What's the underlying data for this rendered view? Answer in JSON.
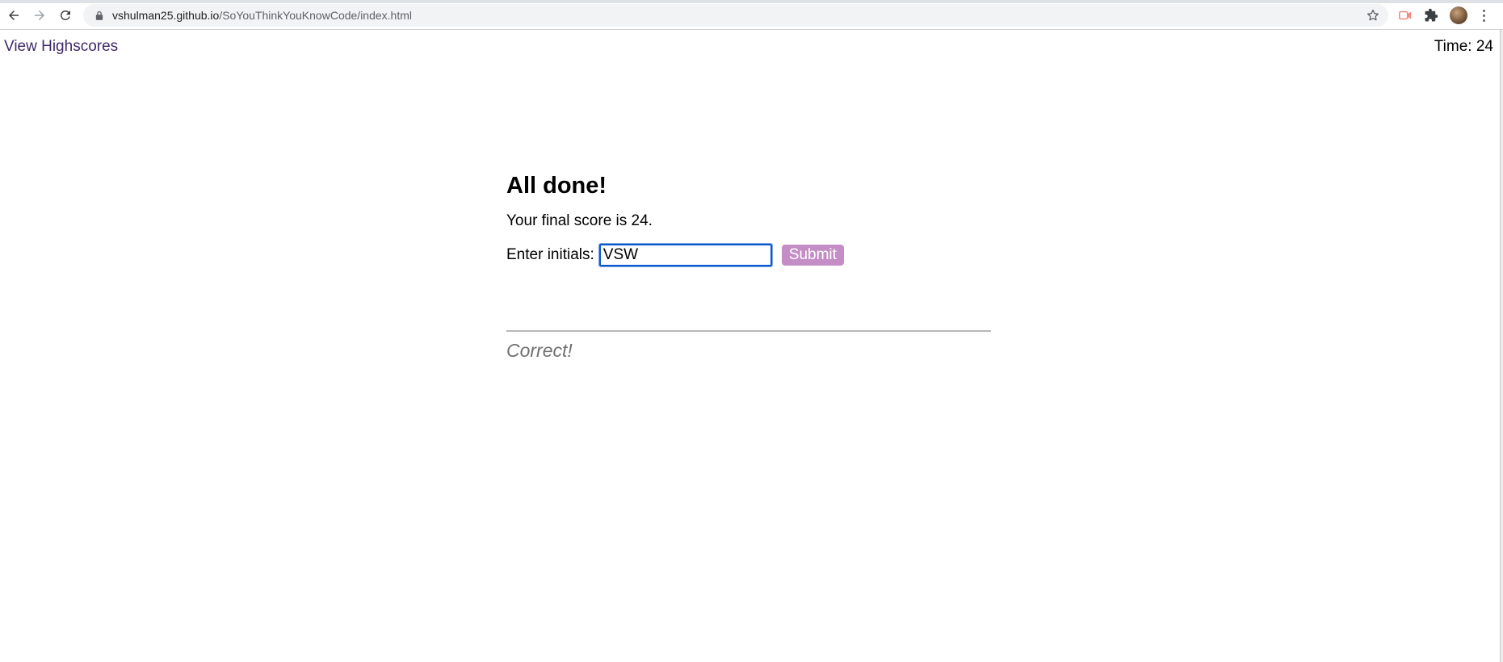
{
  "browser": {
    "url_host": "vshulman25.github.io",
    "url_path": "/SoYouThinkYouKnowCode/index.html",
    "icons": [
      "back-arrow-icon",
      "forward-arrow-icon",
      "reload-icon",
      "lock-icon",
      "star-icon",
      "record-icon",
      "puzzle-extension-icon",
      "profile-avatar",
      "more-menu-icon"
    ]
  },
  "header": {
    "highscores_link": "View Highscores",
    "timer": "Time: 24"
  },
  "end_screen": {
    "heading": "All done!",
    "score_text": "Your final score is 24.",
    "initials_label": "Enter initials:",
    "initials_value": "VSW",
    "submit_label": "Submit"
  },
  "feedback": {
    "text": "Correct!"
  },
  "colors": {
    "link": "#3f2a6b",
    "submit_bg": "#c58dc6",
    "input_focus": "#0b57d0",
    "feedback": "#707070",
    "divider": "#b8b8b8"
  }
}
